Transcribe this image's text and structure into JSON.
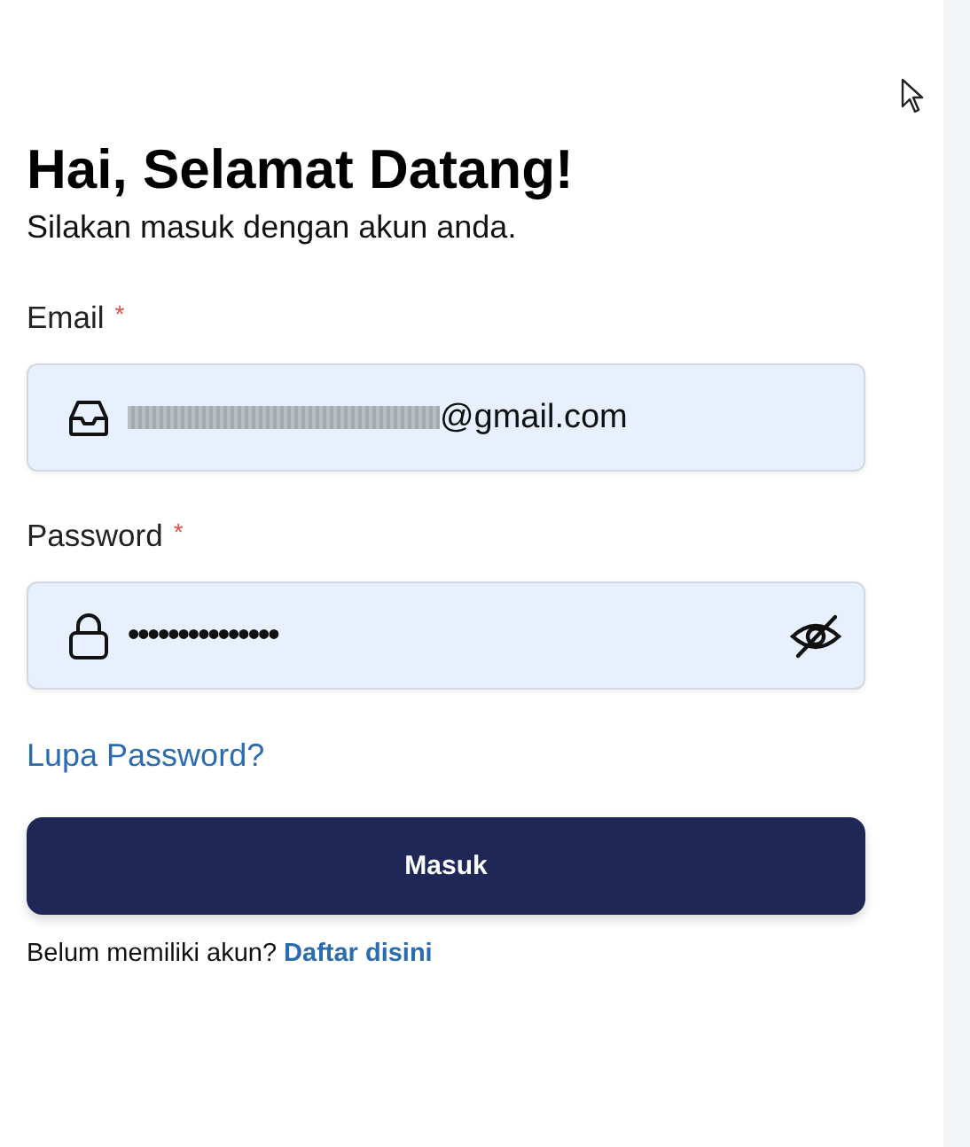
{
  "heading": "Hai, Selamat Datang!",
  "subtitle": "Silakan masuk dengan akun anda.",
  "fields": [
    {
      "kind": "email",
      "label": "Email",
      "required_mark": "*",
      "value_end": "@gmail.com"
    },
    {
      "kind": "password",
      "label": "Password",
      "required_mark": "*",
      "value": "•••••••••••••••"
    }
  ],
  "forgot_link": "Lupa Password?",
  "submit_button": "Masuk",
  "signup": {
    "text": "Belum memiliki akun?",
    "link": "Daftar disini"
  }
}
